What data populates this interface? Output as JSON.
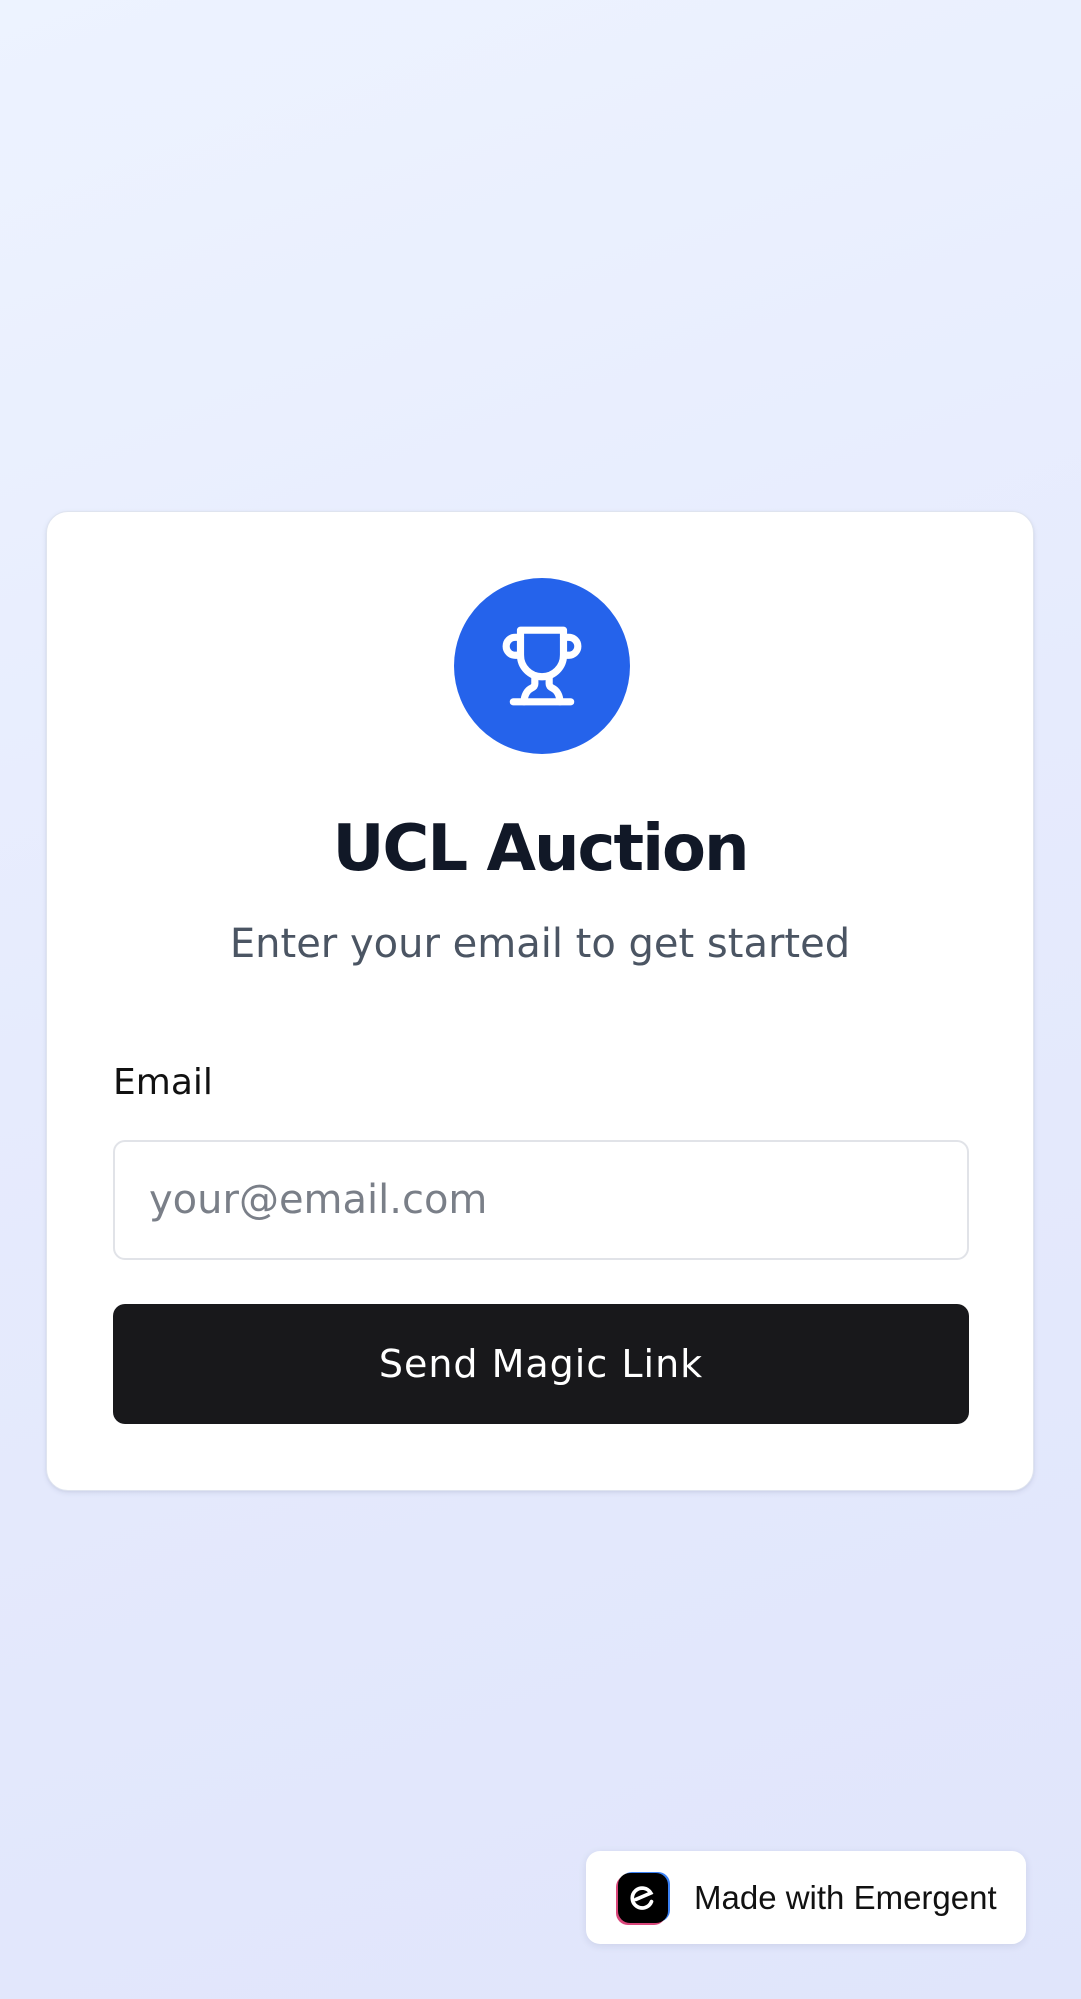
{
  "login_card": {
    "logo_icon": "trophy-icon",
    "title": "UCL Auction",
    "subtitle": "Enter your email to get started",
    "email_label": "Email",
    "email_placeholder": "your@email.com",
    "email_value": "",
    "submit_label": "Send Magic Link"
  },
  "badge": {
    "icon": "emergent-logo-icon",
    "text": "Made with Emergent"
  },
  "colors": {
    "accent": "#2563eb",
    "button": "#18181b",
    "title": "#111827",
    "subtitle": "#4b5563"
  }
}
